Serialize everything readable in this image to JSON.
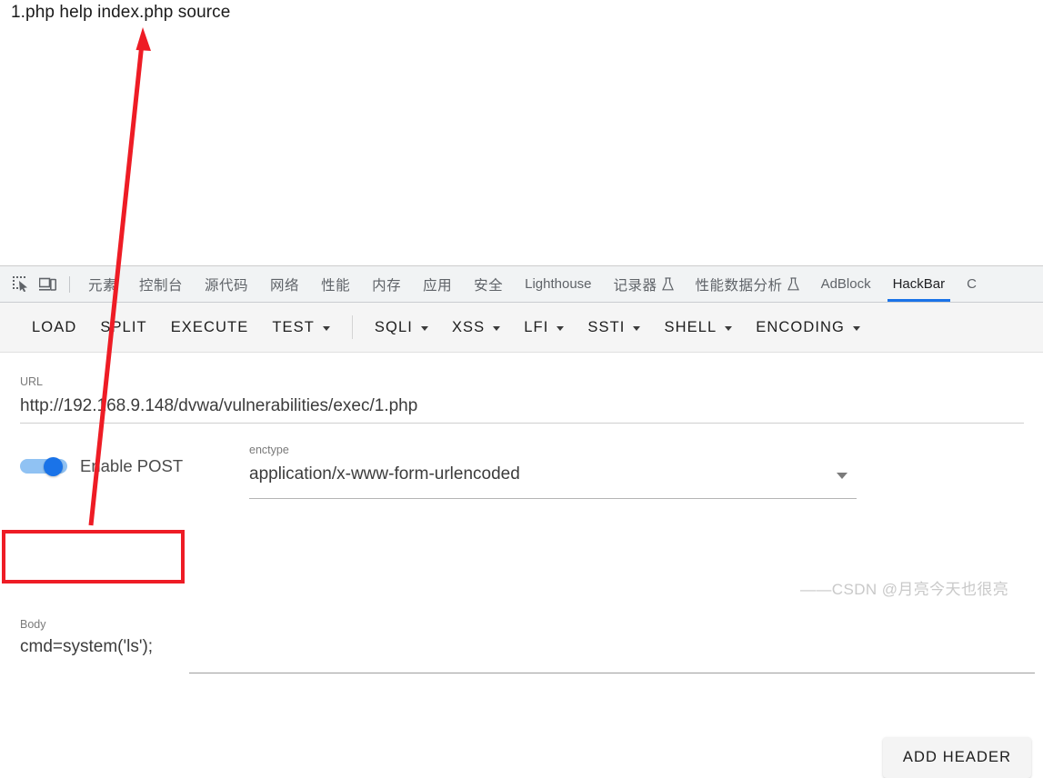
{
  "page": {
    "heading": "1.php help index.php source"
  },
  "devtools": {
    "left_icons": [
      {
        "name": "inspect-element-icon",
        "label": "inspect"
      },
      {
        "name": "device-toolbar-icon",
        "label": "device toolbar"
      }
    ],
    "tabs": [
      {
        "label": "元素",
        "cjk": true,
        "flask": false,
        "active": false
      },
      {
        "label": "控制台",
        "cjk": true,
        "flask": false,
        "active": false
      },
      {
        "label": "源代码",
        "cjk": true,
        "flask": false,
        "active": false
      },
      {
        "label": "网络",
        "cjk": true,
        "flask": false,
        "active": false
      },
      {
        "label": "性能",
        "cjk": true,
        "flask": false,
        "active": false
      },
      {
        "label": "内存",
        "cjk": true,
        "flask": false,
        "active": false
      },
      {
        "label": "应用",
        "cjk": true,
        "flask": false,
        "active": false
      },
      {
        "label": "安全",
        "cjk": true,
        "flask": false,
        "active": false
      },
      {
        "label": "Lighthouse",
        "cjk": false,
        "flask": false,
        "active": false
      },
      {
        "label": "记录器",
        "cjk": true,
        "flask": true,
        "active": false
      },
      {
        "label": "性能数据分析",
        "cjk": true,
        "flask": true,
        "active": false
      },
      {
        "label": "AdBlock",
        "cjk": false,
        "flask": false,
        "active": false
      },
      {
        "label": "HackBar",
        "cjk": false,
        "flask": false,
        "active": true
      },
      {
        "label": "C",
        "cjk": false,
        "flask": false,
        "active": false
      }
    ],
    "active_tab_color": "#1a73e8"
  },
  "hackbar": {
    "toolbar": [
      {
        "label": "LOAD",
        "caret": false,
        "separator_after": false
      },
      {
        "label": "SPLIT",
        "caret": false,
        "separator_after": false
      },
      {
        "label": "EXECUTE",
        "caret": false,
        "separator_after": false
      },
      {
        "label": "TEST",
        "caret": true,
        "separator_after": true
      },
      {
        "label": "SQLI",
        "caret": true,
        "separator_after": false
      },
      {
        "label": "XSS",
        "caret": true,
        "separator_after": false
      },
      {
        "label": "LFI",
        "caret": true,
        "separator_after": false
      },
      {
        "label": "SSTI",
        "caret": true,
        "separator_after": false
      },
      {
        "label": "SHELL",
        "caret": true,
        "separator_after": false
      },
      {
        "label": "ENCODING",
        "caret": true,
        "separator_after": false
      }
    ],
    "url": {
      "label": "URL",
      "value": "http://192.168.9.148/dvwa/vulnerabilities/exec/1.php"
    },
    "post_toggle": {
      "label": "Enable POST",
      "enabled": true,
      "on_color": "#1a73e8"
    },
    "enctype": {
      "label": "enctype",
      "value": "application/x-www-form-urlencoded"
    },
    "add_header_label": "ADD HEADER",
    "body": {
      "label": "Body",
      "value": "cmd=system('ls');"
    }
  },
  "annotations": {
    "arrow_color": "#ee1c25",
    "box_color": "#ee1c25",
    "watermark": "——CSDN @月亮今天也很亮"
  }
}
